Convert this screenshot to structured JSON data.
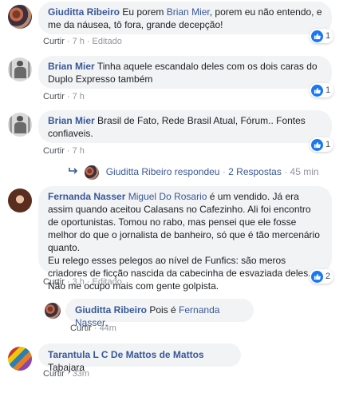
{
  "comments": [
    {
      "author": "Giuditta Ribeiro",
      "text_before_mention": "Eu porem",
      "mention": "Brian Mier",
      "text_after_mention": ", porem eu não entendo, e me da náusea, tô fora, grande decepção!",
      "actions": {
        "reply": "Curtir",
        "time": "7 h",
        "edited": "Editado"
      },
      "reactions": {
        "count": "1",
        "icon": "like-icon"
      }
    },
    {
      "author": "Brian Mier",
      "text": "Tinha aquele escandalo deles com os dois caras do Duplo Expresso também",
      "actions": {
        "reply": "Curtir",
        "time": "7 h"
      },
      "reactions": {
        "count": "1",
        "icon": "like-icon"
      }
    },
    {
      "author": "Brian Mier",
      "text": "Brasil de Fato, Rede Brasil Atual, Fórum.. Fontes confiaveis.",
      "actions": {
        "reply": "Curtir",
        "time": "7 h"
      },
      "reactions": {
        "count": "1",
        "icon": "like-icon"
      }
    },
    {
      "author": "Fernanda Nasser",
      "mention": "Miguel Do Rosario",
      "text_after_mention": " é um vendido. Já era assim quando aceitou Calasans no Cafezinho. Ali foi encontro de oportunistas. Tomou no rabo, mas pensei que ele fosse melhor do que o jornalista de banheiro, só que é tão mercenário quanto.",
      "text_para2": "Eu relego esses pelegos ao nível de Funfics: são meros criadores de ficção nascida da cabecinha de esvaziada deles. Não me ocupo mais com gente golpista.",
      "actions": {
        "reply": "Curtir",
        "time": "3 h",
        "edited": "Editado"
      },
      "reactions": {
        "count": "2",
        "icon": "like-icon"
      }
    },
    {
      "author": "Giuditta Ribeiro",
      "text_before_mention": "Pois é",
      "mention": "Fernanda Nasser.",
      "actions": {
        "reply": "Curtir",
        "time": "44m"
      }
    },
    {
      "author": "Tarantula L C De Mattos de Mattos",
      "text": "Tabajara",
      "actions": {
        "reply": "Curtir",
        "time": "33m"
      }
    }
  ],
  "reply_summary": {
    "icon": "reply-arrow-icon",
    "author": "Giuditta Ribeiro",
    "verb": "respondeu",
    "count_text": "2 Respostas",
    "time": "45 min"
  },
  "colors": {
    "link": "#385898",
    "bubble": "#f2f3f5",
    "like": "#1877f2",
    "meta": "#90949c"
  }
}
